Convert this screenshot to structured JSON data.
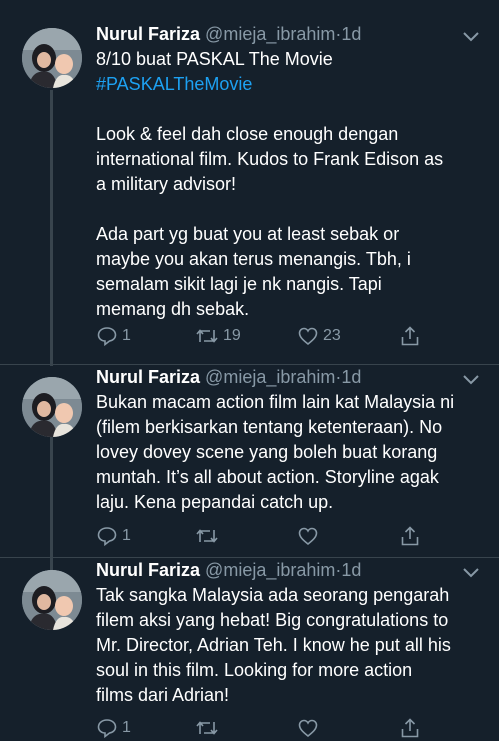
{
  "tweets": [
    {
      "name": "Nurul Fariza",
      "handle": "@mieja_ibrahim",
      "sep": "·",
      "age": "1d",
      "lines": [
        "8/10 buat PASKAL The Movie",
        "#PASKALTheMovie",
        "",
        "Look & feel dah close enough dengan",
        "international film. Kudos to Frank Edison as",
        "a military advisor!",
        "",
        "Ada part yg buat you at least sebak or",
        "maybe you akan terus menangis. Tbh, i",
        "semalam sikit lagi je nk nangis. Tapi",
        "memang dh sebak."
      ],
      "replies": "1",
      "retweets": "19",
      "likes": "23"
    },
    {
      "name": "Nurul Fariza",
      "handle": "@mieja_ibrahim",
      "sep": "·",
      "age": "1d",
      "lines": [
        "Bukan macam action film lain kat Malaysia ni",
        "(filem berkisarkan tentang ketenteraan). No",
        "lovey dovey scene yang boleh buat korang",
        "muntah. It’s all about action. Storyline agak",
        "laju. Kena pepandai catch up."
      ],
      "replies": "1",
      "retweets": "",
      "likes": ""
    },
    {
      "name": "Nurul Fariza",
      "handle": "@mieja_ibrahim",
      "sep": "·",
      "age": "1d",
      "lines": [
        "Tak sangka Malaysia ada seorang pengarah",
        "filem aksi yang hebat! Big congratulations to",
        "Mr. Director, Adrian Teh. I know he put all his",
        "soul in this film. Looking for more action",
        "films dari Adrian!"
      ],
      "replies": "1",
      "retweets": "",
      "likes": ""
    }
  ],
  "colors": {
    "background": "#15202b",
    "text": "#ffffff",
    "secondary": "#8899a6",
    "link": "#1da1f2",
    "divider": "#38444d"
  },
  "icons": [
    "reply-icon",
    "retweet-icon",
    "like-icon",
    "share-icon",
    "chevron-down-icon"
  ]
}
